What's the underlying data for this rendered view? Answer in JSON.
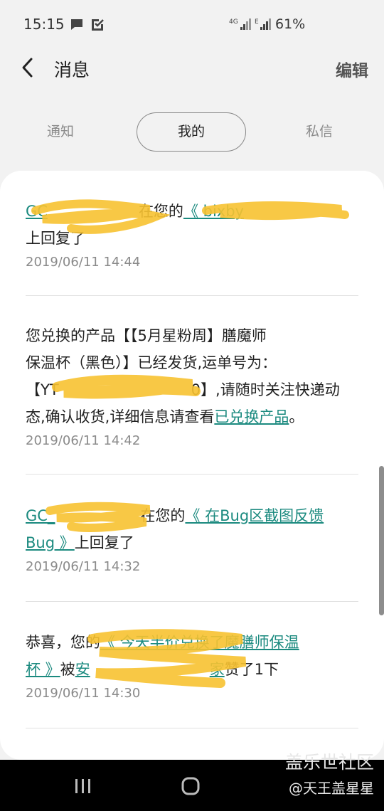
{
  "status": {
    "time": "15:15",
    "network": "4G",
    "network2": "E",
    "battery": "61%"
  },
  "header": {
    "title": "消息",
    "edit": "编辑"
  },
  "tabs": {
    "notify": "通知",
    "mine": "我的",
    "private": "私信"
  },
  "messages": [
    {
      "user": "GC",
      "prefix": "在您的",
      "post": "《 bixby",
      "suffix": "上回复了",
      "time": "2019/06/11 14:44"
    },
    {
      "line1": "您兑换的产品【【5月星粉周】膳魔师",
      "line2": "保温杯（黑色）】已经发货,运单号为：",
      "line3a": "【YT",
      "line3b": "0】,请随时关注快递动",
      "line4a": "态,确认收货,详细信息请查看",
      "link": "已兑换产品",
      "line4c": "。",
      "time": "2019/06/11 14:42"
    },
    {
      "user": "GC_",
      "prefix": "在您的",
      "post1": "《 在Bug区截图反馈",
      "post2": "Bug 》",
      "suffix": "上回复了",
      "time": "2019/06/11 14:32"
    },
    {
      "prefix": "恭喜，您的",
      "post1": "《 今天半价兑换了魔膳师保温",
      "post2": "杯 》",
      "mid": "被",
      "user": "安",
      "user_end": "家",
      "suffix": "赞了1下",
      "time": "2019/06/11 14:30"
    }
  ],
  "watermark": {
    "line1": "盖乐世社区",
    "line2": "@天王盖星星"
  }
}
